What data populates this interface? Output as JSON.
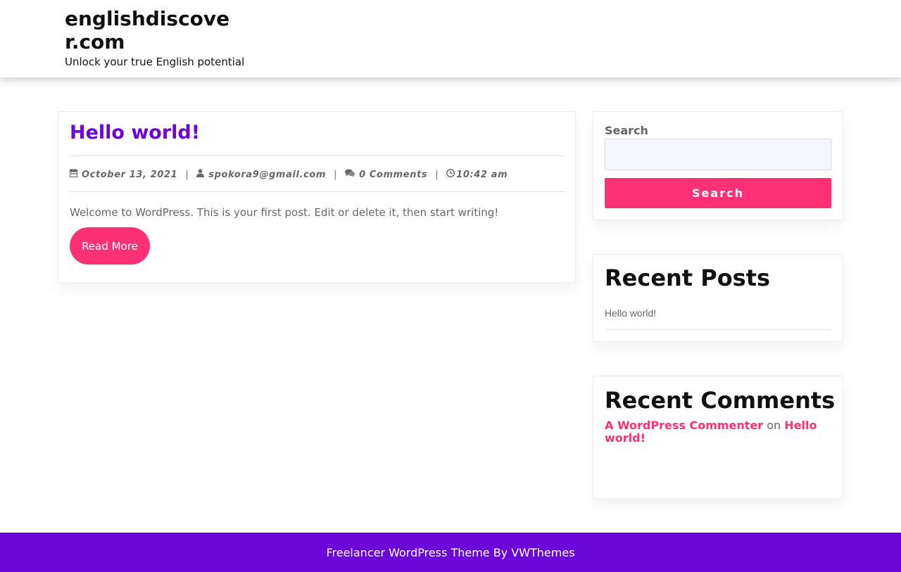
{
  "header": {
    "site_title": "englishdiscover.com",
    "tagline": "Unlock your true English potential"
  },
  "post": {
    "title": "Hello world!",
    "date": "October 13, 2021",
    "author": "spokora9@gmail.com",
    "comments": "0 Comments",
    "time": "10:42 am",
    "separator": "|",
    "excerpt": "Welcome to WordPress. This is your first post. Edit or delete it, then start writing!",
    "read_more_label": "Read More"
  },
  "sidebar": {
    "search": {
      "label": "Search",
      "placeholder": "",
      "button_label": "Search"
    },
    "recent_posts": {
      "title": "Recent Posts",
      "items": [
        {
          "label": "Hello world!"
        }
      ]
    },
    "recent_comments": {
      "title": "Recent Comments",
      "items": [
        {
          "author": "A WordPress Commenter",
          "on_text": "on",
          "post": "Hello world!"
        }
      ]
    }
  },
  "footer": {
    "text": "Freelancer WordPress Theme By VWThemes"
  },
  "colors": {
    "accent_pink": "#ff3176",
    "brand_purple": "#6b05d8"
  },
  "icons": {
    "date": "calendar-icon",
    "author": "user-icon",
    "comments": "comments-icon",
    "time": "clock-icon"
  }
}
